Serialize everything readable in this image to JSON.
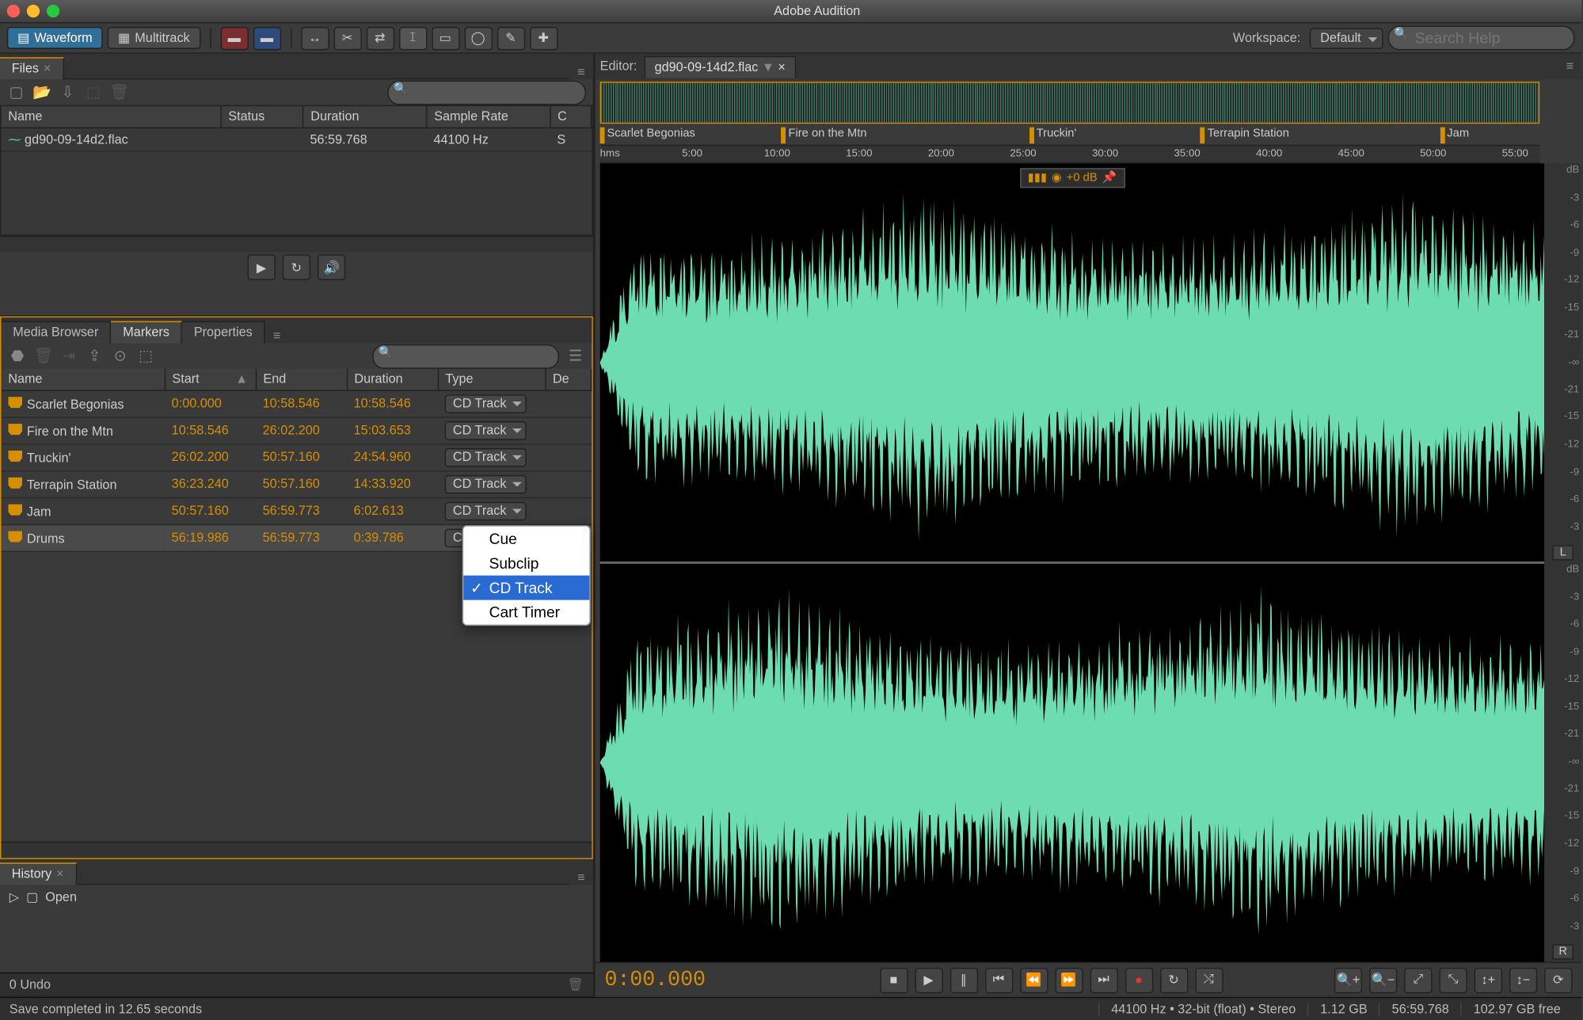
{
  "app": {
    "title": "Adobe Audition"
  },
  "toolbar": {
    "waveform": "Waveform",
    "multitrack": "Multitrack",
    "workspace_label": "Workspace:",
    "workspace_value": "Default",
    "search_placeholder": "Search Help"
  },
  "files_panel": {
    "tab": "Files",
    "cols": {
      "name": "Name",
      "status": "Status",
      "duration": "Duration",
      "samplerate": "Sample Rate",
      "ch": "C"
    },
    "rows": [
      {
        "name": "gd90-09-14d2.flac",
        "status": "",
        "duration": "56:59.768",
        "samplerate": "44100 Hz",
        "ch": "S"
      }
    ]
  },
  "tabs3": {
    "media": "Media Browser",
    "markers": "Markers",
    "properties": "Properties"
  },
  "markers_panel": {
    "cols": {
      "name": "Name",
      "start": "Start",
      "end": "End",
      "duration": "Duration",
      "type": "Type",
      "de": "De"
    },
    "rows": [
      {
        "name": "Scarlet Begonias",
        "start": "0:00.000",
        "end": "10:58.546",
        "dur": "10:58.546",
        "type": "CD Track"
      },
      {
        "name": "Fire on the Mtn",
        "start": "10:58.546",
        "end": "26:02.200",
        "dur": "15:03.653",
        "type": "CD Track"
      },
      {
        "name": "Truckin'",
        "start": "26:02.200",
        "end": "50:57.160",
        "dur": "24:54.960",
        "type": "CD Track"
      },
      {
        "name": "Terrapin Station",
        "start": "36:23.240",
        "end": "50:57.160",
        "dur": "14:33.920",
        "type": "CD Track"
      },
      {
        "name": "Jam",
        "start": "50:57.160",
        "end": "56:59.773",
        "dur": "6:02.613",
        "type": "CD Track"
      },
      {
        "name": "Drums",
        "start": "56:19.986",
        "end": "56:59.773",
        "dur": "0:39.786",
        "type": "CD Track"
      }
    ],
    "dropdown": {
      "items": [
        "Cue",
        "Subclip",
        "CD Track",
        "Cart Timer"
      ],
      "selected": "CD Track"
    }
  },
  "history_panel": {
    "tab": "History",
    "item": "Open",
    "undo_status": "0 Undo"
  },
  "editor": {
    "label": "Editor:",
    "file": "gd90-09-14d2.flac",
    "volume": "+0 dB",
    "markers": [
      {
        "name": "Scarlet Begonias",
        "pct": 0
      },
      {
        "name": "Fire on the Mtn",
        "pct": 19.3
      },
      {
        "name": "Truckin'",
        "pct": 45.7
      },
      {
        "name": "Terrapin Station",
        "pct": 63.9
      },
      {
        "name": "Jam",
        "pct": 89.4
      }
    ],
    "ruler": [
      "hms",
      "5:00",
      "10:00",
      "15:00",
      "20:00",
      "25:00",
      "30:00",
      "35:00",
      "40:00",
      "45:00",
      "50:00",
      "55:00"
    ],
    "db_ticks": [
      "dB",
      "-3",
      "-6",
      "-9",
      "-12",
      "-15",
      "-21",
      "-∞",
      "-21",
      "-15",
      "-12",
      "-9",
      "-6",
      "-3"
    ],
    "ch": {
      "l": "L",
      "r": "R"
    }
  },
  "transport": {
    "timecode": "0:00.000"
  },
  "status": {
    "left": "Save completed in 12.65 seconds",
    "format": "44100 Hz • 32-bit (float) • Stereo",
    "size": "1.12 GB",
    "duration": "56:59.768",
    "free": "102.97 GB free"
  }
}
